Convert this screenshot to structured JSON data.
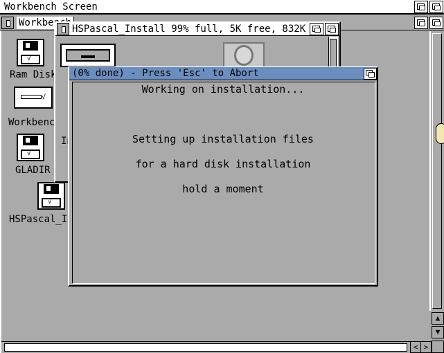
{
  "screen": {
    "title": "Workbench Screen"
  },
  "workbench_window": {
    "title": "Workbench"
  },
  "icons": [
    {
      "label": "Ram Disk"
    },
    {
      "label": "Workbench"
    },
    {
      "label": "GLADIR"
    },
    {
      "label": "HSPascal_In"
    }
  ],
  "partial_labels": {
    "drawer_behind": "In"
  },
  "hspascal_window": {
    "title": "HSPascal_Install  99% full, 5K free, 832K"
  },
  "progress_window": {
    "title": "(0% done) - Press 'Esc' to Abort",
    "heading": "Working on installation...",
    "lines": [
      "Setting up installation files",
      "for a hard disk installation",
      "hold a moment"
    ]
  },
  "scroll_glyphs": {
    "up": "▲",
    "down": "▼",
    "left": "<",
    "right": ">"
  },
  "colors": {
    "background": "#aaaaaa",
    "active_title": "#6b8ebf",
    "highlight": "#ffffff"
  }
}
